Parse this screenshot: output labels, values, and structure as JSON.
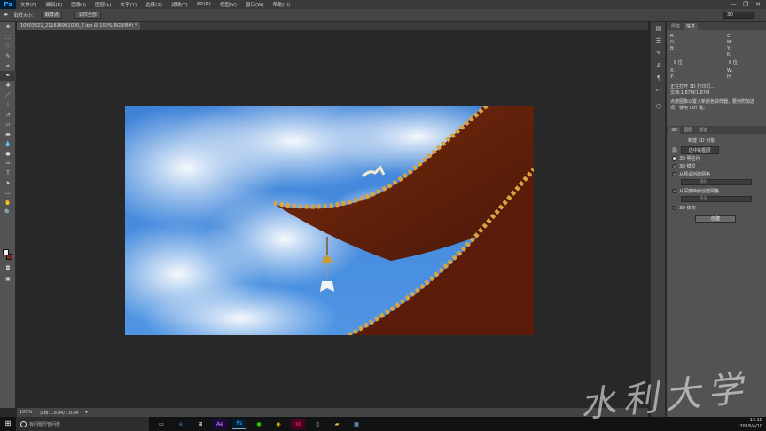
{
  "app": {
    "logo_text": "Ps"
  },
  "menu": {
    "items": [
      "文件(F)",
      "编辑(E)",
      "图像(I)",
      "图层(L)",
      "文字(Y)",
      "选择(S)",
      "滤镜(T)",
      "3D(D)",
      "视图(V)",
      "窗口(W)",
      "帮助(H)"
    ],
    "window_controls": {
      "minimize": "—",
      "restore": "❐",
      "close": "✕"
    }
  },
  "options_bar": {
    "sample_size_label": "取样大小：",
    "sample_size_value": "取样点",
    "show_ring_button": "调样全部",
    "workspace_value": "3D"
  },
  "document": {
    "tab_title": "10903821_211616901000_7.jpg @ 100%(RGB/8#) *"
  },
  "status": {
    "zoom": "100%",
    "doc_size": "文档:1.87M/1.87M"
  },
  "panels": {
    "top_tabs": [
      "属性",
      "信息"
    ],
    "info_lines": {
      "r": "R:",
      "g": "G:",
      "b": "B:",
      "c": "C:",
      "m": "M:",
      "y": "Y:",
      "k": "K:",
      "bit_left": "8 位",
      "bit_right": "8 位",
      "x": "X:",
      "y_coord": "Y:",
      "w": "W:",
      "h": "H:"
    },
    "hint_1": "正在打开 3D 打印机...",
    "hint_2": "文档:1.87M/1.87M",
    "hint_3": "点按图像以置入新颜色取样器，要用附加选项，使用 Ctrl 键。",
    "mid_tabs": [
      "3D",
      "图层",
      "通道"
    ],
    "threed": {
      "title": "新建 3D 对象",
      "source_label": "源:",
      "source_value": "选中的图层",
      "options": [
        "3D 明信片",
        "3D 模型",
        "从预设创建网格",
        "从深度映射创建网格",
        "3D 体积"
      ],
      "dropdown_1": "帽形",
      "dropdown_2": "平面",
      "create_button": "创建"
    }
  },
  "taskbar": {
    "search_placeholder": "有问题尽管问我",
    "time": "13:18",
    "date": "2018/4/10"
  },
  "watermark_text": "水利大学"
}
